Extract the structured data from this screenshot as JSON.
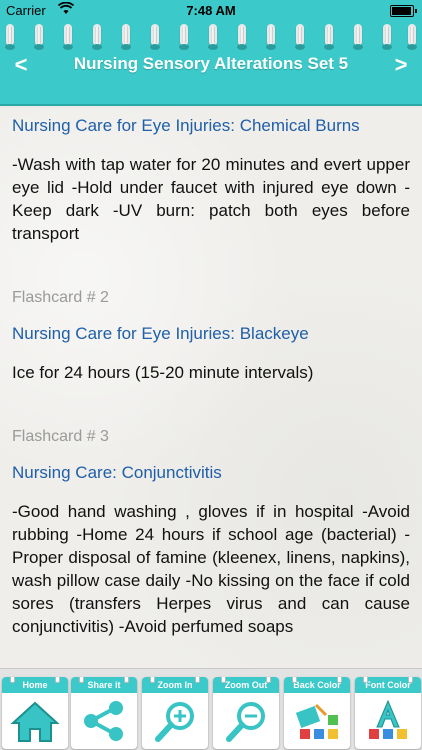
{
  "status_bar": {
    "carrier": "Carrier",
    "time": "7:48 AM"
  },
  "header": {
    "title": "Nursing Sensory Alterations Set 5",
    "prev": "<",
    "next": ">"
  },
  "cards": [
    {
      "label": "",
      "title": "Nursing Care for Eye Injuries: Chemical Burns",
      "body": "-Wash with tap water for 20 minutes and evert upper eye lid -Hold under faucet with injured eye down -Keep dark -UV burn: patch both eyes before transport"
    },
    {
      "label": "Flashcard # 2",
      "title": "Nursing Care for Eye Injuries: Blackeye",
      "body": "Ice for 24 hours (15-20 minute intervals)"
    },
    {
      "label": "Flashcard # 3",
      "title": "Nursing Care: Conjunctivitis",
      "body": "-Good hand washing , gloves if in hospital -Avoid rubbing -Home 24 hours if school age (bacterial) -Proper disposal of famine (kleenex, linens, napkins), wash pillow case daily -No kissing on the face if cold sores (transfers Herpes virus and can cause conjunctivitis) -Avoid perfumed soaps"
    }
  ],
  "toolbar": {
    "home": "Home",
    "share": "Share it",
    "zoom_in": "Zoom In",
    "zoom_out": "Zoom Out",
    "back_color": "Back Color",
    "font_color": "Font Color"
  },
  "colors": {
    "accent": "#3cc9c9",
    "title_blue": "#1f5fa8",
    "label_gray": "#9a9a9a"
  },
  "icons": [
    "wifi-icon",
    "battery-icon",
    "home-icon",
    "share-icon",
    "zoom-in-icon",
    "zoom-out-icon",
    "back-color-icon",
    "font-color-icon"
  ]
}
